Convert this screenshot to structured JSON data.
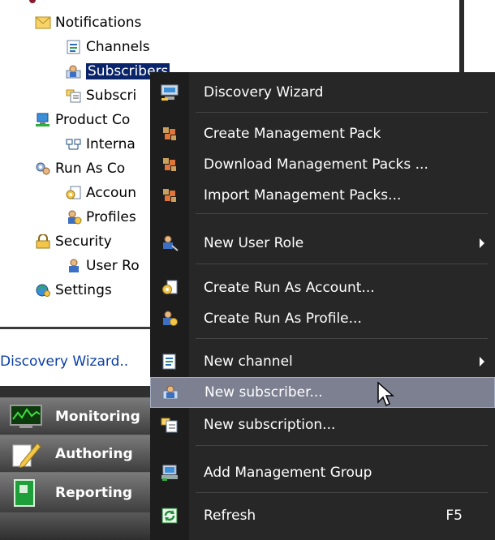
{
  "tree": {
    "items": [
      {
        "label": "Notifications",
        "icon": "envelope-icon"
      },
      {
        "label": "Channels",
        "icon": "channels-icon"
      },
      {
        "label": "Subscribers",
        "icon": "subscriber-icon"
      },
      {
        "label": "Subscri",
        "icon": "subscription-icon"
      },
      {
        "label": "Product Co",
        "icon": "product-connector-icon"
      },
      {
        "label": "Interna",
        "icon": "internal-connector-icon"
      },
      {
        "label": "Run As Co",
        "icon": "run-as-config-icon"
      },
      {
        "label": "Accoun",
        "icon": "account-icon"
      },
      {
        "label": "Profiles",
        "icon": "profiles-icon"
      },
      {
        "label": "Security",
        "icon": "lock-icon"
      },
      {
        "label": "User Ro",
        "icon": "user-role-icon"
      },
      {
        "label": "Settings",
        "icon": "settings-icon"
      }
    ]
  },
  "tasks": {
    "discovery_link": "Discovery Wizard.."
  },
  "wunderbar": {
    "buttons": [
      {
        "label": "Monitoring",
        "icon": "monitor-icon"
      },
      {
        "label": "Authoring",
        "icon": "pencil-icon"
      },
      {
        "label": "Reporting",
        "icon": "report-book-icon"
      }
    ]
  },
  "context_menu": {
    "items": [
      {
        "label": "Discovery Wizard",
        "icon": "discovery-wizard-icon"
      },
      {
        "label": "Create Management Pack",
        "icon": "management-pack-icon"
      },
      {
        "label": "Download Management Packs ...",
        "icon": "management-pack-icon"
      },
      {
        "label": "Import Management Packs...",
        "icon": "management-pack-icon"
      },
      {
        "label": "New User Role",
        "icon": "user-role-icon",
        "submenu": true
      },
      {
        "label": "Create Run As Account...",
        "icon": "run-as-account-icon"
      },
      {
        "label": "Create Run As Profile...",
        "icon": "run-as-profile-icon"
      },
      {
        "label": "New channel",
        "icon": "channel-icon",
        "submenu": true
      },
      {
        "label": "New subscriber...",
        "icon": "subscriber-icon",
        "highlighted": true
      },
      {
        "label": "New subscription...",
        "icon": "subscription-icon"
      },
      {
        "label": "Add Management Group",
        "icon": "management-group-icon"
      },
      {
        "label": "Refresh",
        "icon": "refresh-icon",
        "shortcut": "F5"
      }
    ]
  },
  "colors": {
    "menu_bg": "#272727",
    "menu_highlight": "#7c8090",
    "tree_selection": "#0a246a",
    "link": "#0b3fa8"
  }
}
